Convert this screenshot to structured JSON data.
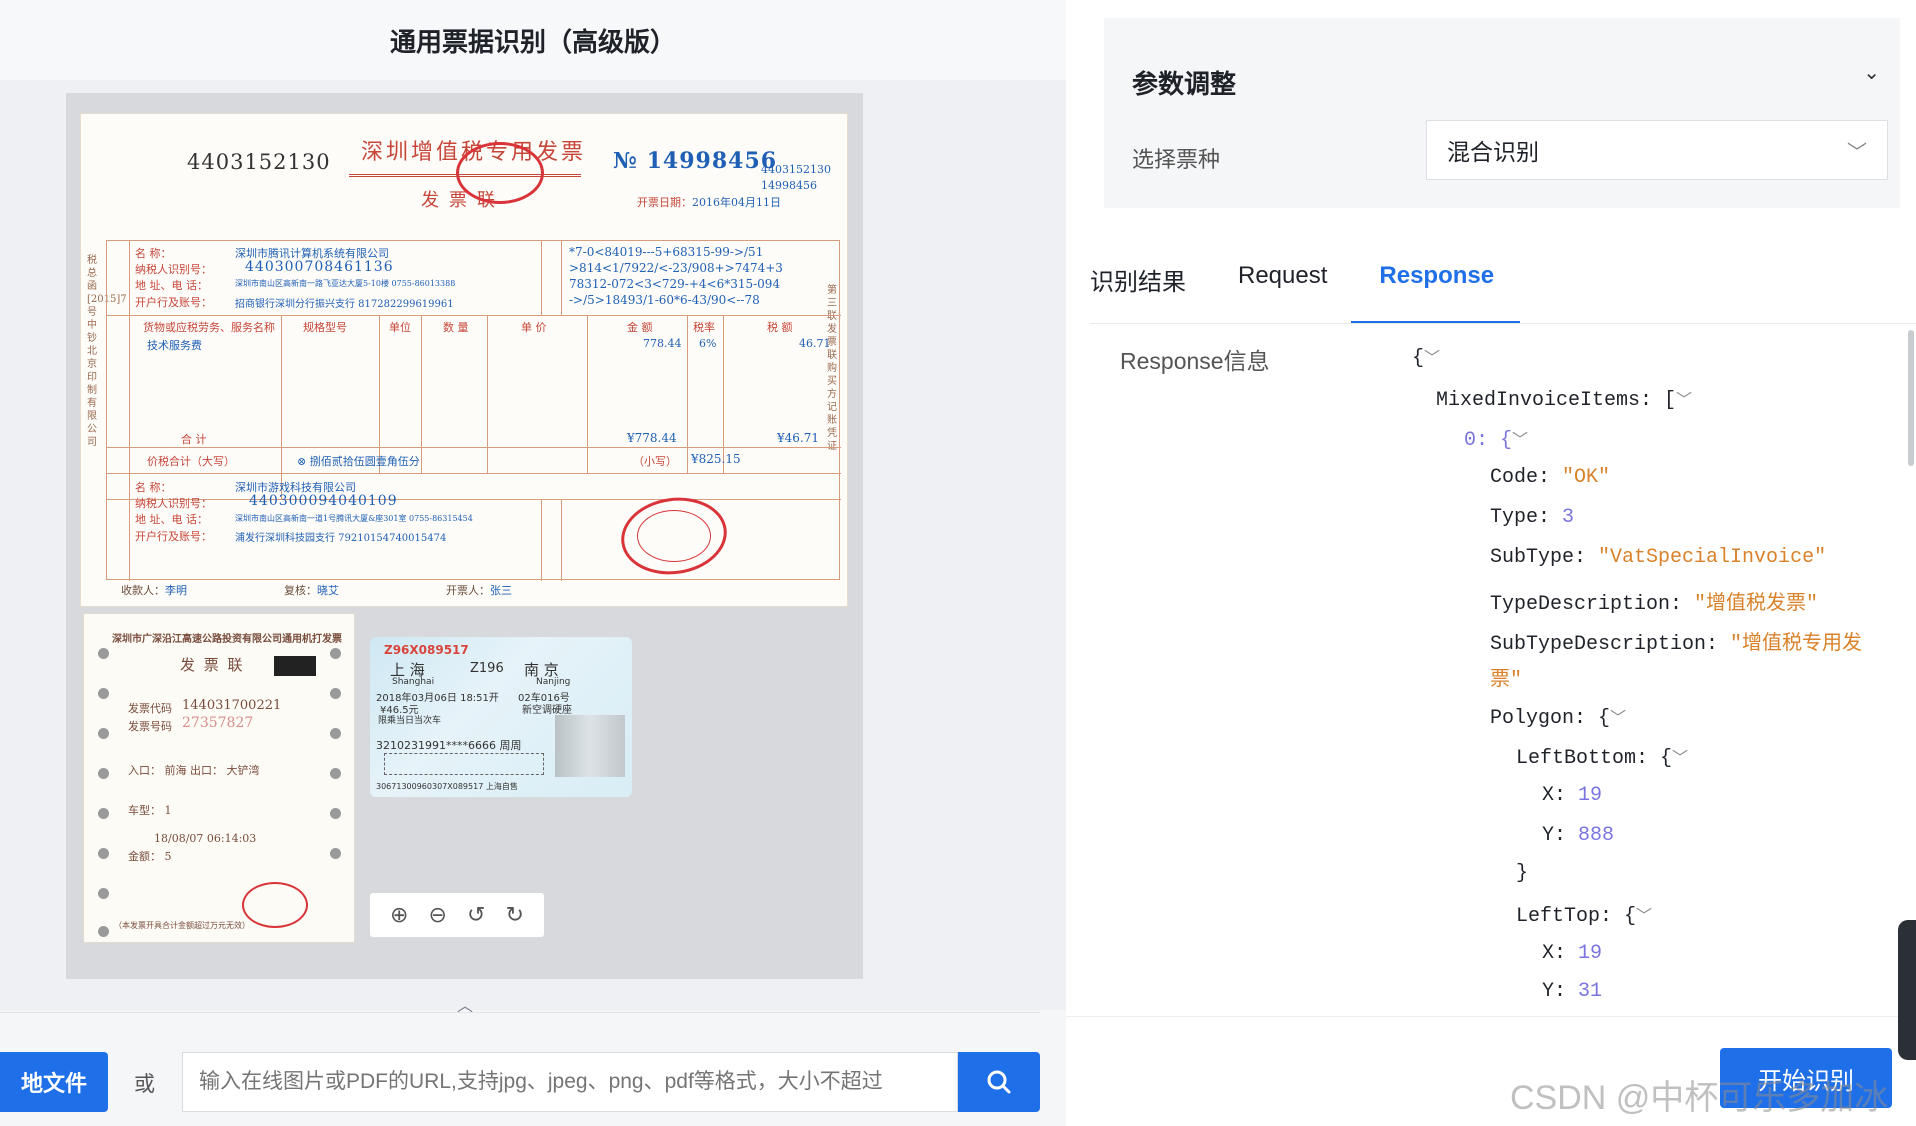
{
  "left": {
    "title": "通用票据识别（高级版）",
    "upload_label": "地文件",
    "or_label": "或",
    "url_placeholder": "输入在线图片或PDF的URL,支持jpg、jpeg、png、pdf等格式，大小不超过"
  },
  "invoice": {
    "code": "4403152130",
    "title": "深圳增值税专用发票",
    "lian": "发票联",
    "no_label": "№",
    "number": "14998456",
    "no_small_1": "4403152130",
    "no_small_2": "14998456",
    "date_label": "开票日期：",
    "date_value": "2016年04月11日",
    "buyer_name_label": "名 称：",
    "buyer_name": "深圳市腾讯计算机系统有限公司",
    "buyer_tax_label": "纳税人识别号：",
    "buyer_tax": "440300708461136",
    "buyer_addr_label": "地 址、电 话：",
    "buyer_addr": "深圳市南山区高新南一路飞亚达大厦5-10楼 0755-86013388",
    "buyer_bank_label": "开户行及账号：",
    "buyer_bank": "招商银行深圳分行振兴支行 817282299619961",
    "cipher_1": "*7-0<84019---5+68315-99->/51",
    "cipher_2": ">814<1/7922/<-23/908+>7474+3",
    "cipher_3": "78312-072<3<729-+4<6*315-094",
    "cipher_4": "->/5>18493/1-60*6-43/90<--78",
    "col_item": "货物或应税劳务、服务名称",
    "col_spec": "规格型号",
    "col_unit": "单位",
    "col_qty": "数 量",
    "col_price": "单 价",
    "col_amount": "金 额",
    "col_rate": "税率",
    "col_tax": "税 额",
    "item_name": "技术服务费",
    "item_amount": "778.44",
    "item_rate": "6%",
    "item_tax": "46.71",
    "sum_label": "合 计",
    "sum_amount": "¥778.44",
    "sum_tax": "¥46.71",
    "total_label": "价税合计（大写）",
    "total_words": "⊗ 捌佰贰拾伍圆壹角伍分",
    "total_small_label": "（小写）",
    "total_small": "¥825.15",
    "seller_name": "深圳市游戏科技有限公司",
    "seller_tax": "440300094040109",
    "seller_addr": "深圳市南山区高新南一道1号腾讯大厦&座301室 0755-86315454",
    "seller_bank": "浦发行深圳科技园支行 79210154740015474",
    "payee_label": "收款人：",
    "payee": "李明",
    "reviewer_label": "复核：",
    "reviewer": "晓艾",
    "drawer_label": "开票人：",
    "drawer": "张三",
    "side_left": "税总函[2015]7号中钞北京印制有限公司",
    "side_right": "第三联：发票联 购买方记账凭证"
  },
  "toll": {
    "title": "深圳市广深沿江高速公路投资有限公司通用机打发票",
    "lian": "发 票 联",
    "code_label": "发票代码",
    "code": "144031700221",
    "num_label": "发票号码",
    "num": "27357827",
    "entry": "入口：",
    "entry_val": "前海",
    "exit": "出口：",
    "exit_val": "大铲湾",
    "car_type": "车型：",
    "car_val": "1",
    "amount_label": "金额：",
    "amount_val": "5",
    "time_val": "18/08/07  06:14:03",
    "footer": "（本发票开具合计金额超过万元无效）"
  },
  "train": {
    "id": "Z96X089517",
    "from": "上 海",
    "train_no": "Z196",
    "to": "南 京",
    "from_en": "Shanghai",
    "to_en": "Nanjing",
    "date": "2018年03月06日 18:51开",
    "seat": "02车016号",
    "price": "¥46.5元",
    "cls": "新空调硬座",
    "note": "限乘当日当次车",
    "idnum": "3210231991****6666 周周",
    "bottom": "30671300960307X089517 上海自售"
  },
  "zoom": {
    "zoom_in": "⊕",
    "zoom_out": "⊖",
    "rot_left": "↺",
    "rot_right": "↻"
  },
  "right": {
    "params_title": "参数调整",
    "ticket_label": "选择票种",
    "ticket_value": "混合识别",
    "tabs": [
      "识别结果",
      "Request",
      "Response"
    ],
    "resp_label": "Response信息",
    "start_label": "开始识别"
  },
  "json_view": {
    "l1": "{",
    "mixed_key": "MixedInvoiceItems: [",
    "idx_key": "0: {",
    "code_key": "Code: ",
    "code_val": "\"OK\"",
    "type_key": "Type: ",
    "type_val": "3",
    "subtype_key": "SubType: ",
    "subtype_val": "\"VatSpecialInvoice\"",
    "typedesc_key": "TypeDescription: ",
    "typedesc_val": "\"增值税发票\"",
    "subtypedesc_key": "SubTypeDescription: ",
    "subtypedesc_val": "\"增值税专用发",
    "subtypedesc_val2": "票\"",
    "polygon_key": "Polygon: {",
    "lb_key": "LeftBottom: {",
    "x_key": "X: ",
    "lb_x": "19",
    "y_key": "Y: ",
    "lb_y": "888",
    "close": "}",
    "lt_key": "LeftTop: {",
    "lt_x": "19",
    "lt_y": "31"
  },
  "watermark": "CSDN @中杯可乐多加冰"
}
